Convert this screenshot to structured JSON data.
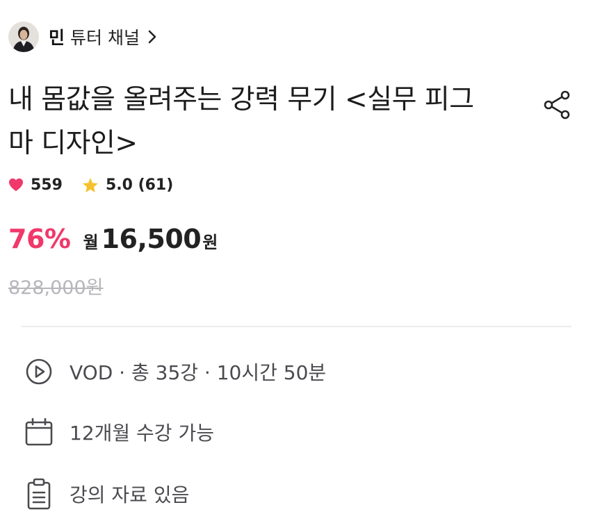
{
  "tutor": {
    "name": "민",
    "suffix": "튜터 채널",
    "avatar_icon": "person-avatar-icon",
    "chevron_icon": "chevron-right-icon"
  },
  "course": {
    "title": "내 몸값을 올려주는 강력 무기 <실무 피그마 디자인>",
    "share_icon": "share-icon"
  },
  "stats": {
    "likes": "559",
    "like_icon": "heart-icon",
    "like_color": "#f0386b",
    "rating": "5.0 (61)",
    "star_icon": "star-icon",
    "star_color": "#f5c22f"
  },
  "price": {
    "discount": "76%",
    "period": "월",
    "amount": "16,500",
    "currency": "원",
    "original": "828,000원",
    "accent_color": "#f0386b"
  },
  "info": [
    {
      "icon": "play-circle-icon",
      "text": "VOD · 총 35강 · 10시간 50분"
    },
    {
      "icon": "calendar-icon",
      "text": "12개월 수강 가능"
    },
    {
      "icon": "clipboard-icon",
      "text": "강의 자료 있음"
    }
  ]
}
